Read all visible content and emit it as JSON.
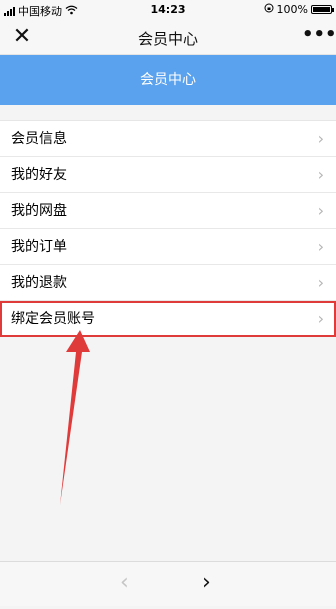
{
  "status_bar": {
    "carrier": "中国移动",
    "time": "14:23",
    "battery": "100%",
    "battery_level": 1.0,
    "wifi_icon": "wifi-icon",
    "lock_icon": "orientation-lock-icon"
  },
  "nav": {
    "title": "会员中心",
    "close_icon": "close-icon",
    "close_glyph": "✕",
    "more_icon": "more-icon",
    "more_glyph": "•••"
  },
  "banner": {
    "title": "会员中心",
    "color": "#5aa2ee"
  },
  "menu": {
    "chevron_glyph": "›",
    "items": [
      {
        "label": "会员信息"
      },
      {
        "label": "我的好友"
      },
      {
        "label": "我的网盘"
      },
      {
        "label": "我的订单"
      },
      {
        "label": "我的退款"
      },
      {
        "label": "绑定会员账号",
        "highlighted": true
      }
    ]
  },
  "annotation": {
    "color": "#e03b3b"
  },
  "bottom_bar": {
    "back_glyph": "‹",
    "forward_glyph": "›"
  }
}
